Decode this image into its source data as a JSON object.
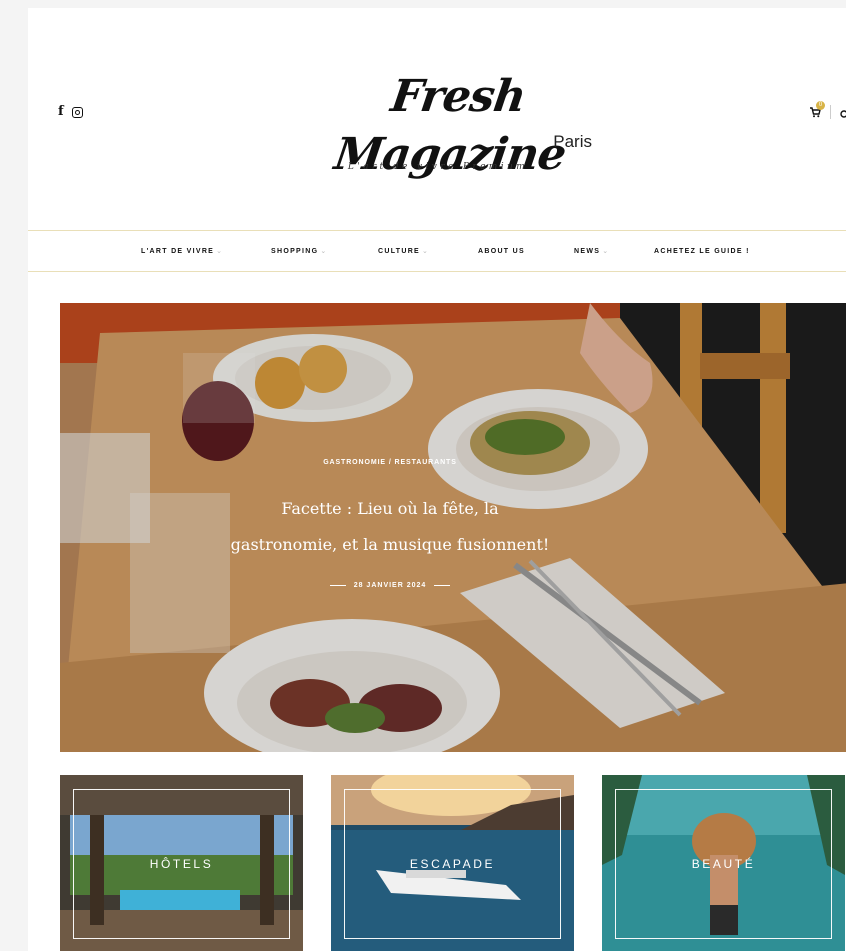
{
  "header": {
    "logo_main": "Fresh Magazine",
    "logo_sub": "Paris",
    "tagline": "L'art de vivre Premium",
    "cart_count": "0"
  },
  "nav": {
    "items": [
      {
        "label": "L'ART DE VIVRE",
        "chevron": "⌄"
      },
      {
        "label": "SHOPPING",
        "chevron": "⌄"
      },
      {
        "label": "CULTURE",
        "chevron": "⌄"
      },
      {
        "label": "ABOUT US",
        "chevron": ""
      },
      {
        "label": "NEWS",
        "chevron": "⌄"
      },
      {
        "label": "ACHETEZ LE GUIDE !",
        "chevron": ""
      }
    ]
  },
  "hero": {
    "categories": "GASTRONOMIE / RESTAURANTS",
    "title": "Facette : Lieu où la fête, la gastronomie, et la musique fusionnent!",
    "date": "28 JANVIER 2024"
  },
  "cards": [
    {
      "label": "HÔTELS"
    },
    {
      "label": "ESCAPADE"
    },
    {
      "label": "BEAUTÉ"
    }
  ],
  "icons": [
    "facebook-icon",
    "instagram-icon",
    "cart-icon",
    "search-icon"
  ],
  "colors": {
    "accent": "#d8b447",
    "nav_border": "#e9dfb8"
  }
}
